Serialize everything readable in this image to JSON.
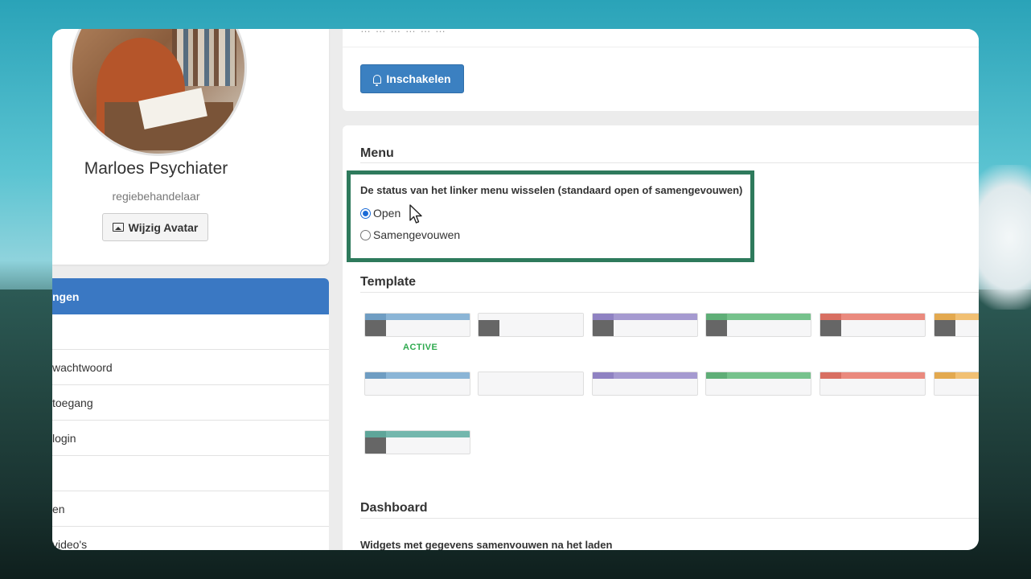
{
  "profile": {
    "name": "Marloes Psychiater",
    "role": "regiebehandelaar",
    "avatar_button": "Wijzig Avatar"
  },
  "left_menu": {
    "active_item": "ngen",
    "items": [
      "",
      "wachtwoord",
      "toegang",
      "login",
      "",
      "en",
      "video's"
    ]
  },
  "top_card": {
    "partial_text": "…                                           …   …                                          …                 …   …",
    "enable_button": "Inschakelen"
  },
  "menu_section": {
    "title": "Menu",
    "question": "De status van het linker menu wisselen (standaard open of samengevouwen)",
    "options": [
      {
        "label": "Open",
        "checked": true
      },
      {
        "label": "Samengevouwen",
        "checked": false
      }
    ],
    "highlight_color": "#2e7a5c"
  },
  "template_section": {
    "title": "Template",
    "active_label": "ACTIVE",
    "swatches": [
      {
        "bar": "#8bb5d6",
        "bar_dark": "#6f9dc2",
        "side": true,
        "active": true
      },
      {
        "bar": "#ffffff",
        "bar_dark": "#ffffff",
        "side": true
      },
      {
        "bar": "#a59ad0",
        "bar_dark": "#8f82c2",
        "side": true
      },
      {
        "bar": "#76c28c",
        "bar_dark": "#5fae77",
        "side": true
      },
      {
        "bar": "#ea8a7e",
        "bar_dark": "#d86f62",
        "side": true
      },
      {
        "bar": "#f1c073",
        "bar_dark": "#e3a94f",
        "side": true
      },
      {
        "bar": "#8bb5d6",
        "bar_dark": "#6f9dc2",
        "side": false
      },
      {
        "bar": "#ffffff",
        "bar_dark": "#ffffff",
        "side": false
      },
      {
        "bar": "#a59ad0",
        "bar_dark": "#8f82c2",
        "side": false
      },
      {
        "bar": "#76c28c",
        "bar_dark": "#5fae77",
        "side": false
      },
      {
        "bar": "#ea8a7e",
        "bar_dark": "#d86f62",
        "side": false
      },
      {
        "bar": "#f1c073",
        "bar_dark": "#e3a94f",
        "side": false
      },
      {
        "bar": "#74b7ad",
        "bar_dark": "#5ea599",
        "side": true
      }
    ]
  },
  "dashboard_section": {
    "title": "Dashboard",
    "subtitle": "Widgets met gegevens samenvouwen na het laden"
  },
  "colors": {
    "primary": "#3b80c1",
    "active_menu": "#3a78c3",
    "active_label": "#2eaa4e"
  }
}
